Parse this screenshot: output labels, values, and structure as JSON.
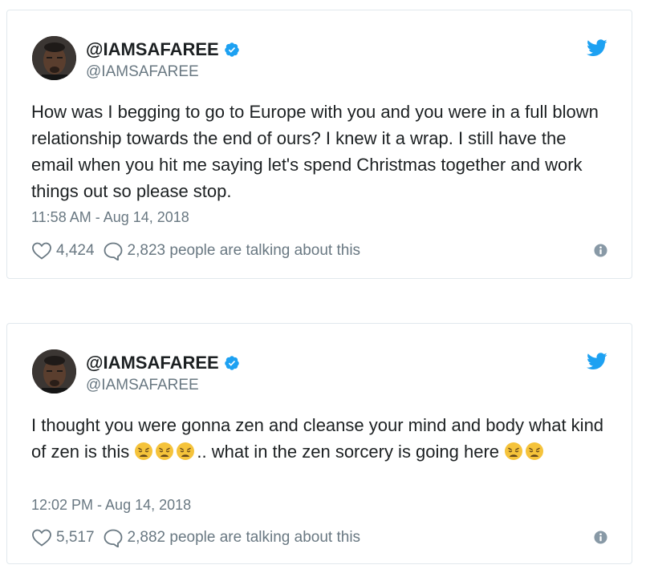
{
  "tweets": [
    {
      "author": {
        "display_name": "@IAMSAFAREE",
        "handle": "@IAMSAFAREE",
        "verified": true
      },
      "text": "How was I begging to go to Europe with you and you were in a full blown relationship towards the end of ours? I knew it a wrap. I still have the email when you hit me saying let's spend Christmas together and work things out so please stop.",
      "timestamp": "11:58 AM - Aug 14, 2018",
      "likes": "4,424",
      "talking": "2,823 people are talking about this"
    },
    {
      "author": {
        "display_name": "@IAMSAFAREE",
        "handle": "@IAMSAFAREE",
        "verified": true
      },
      "text_part1": "I thought you were gonna zen and cleanse  your mind and body what kind of zen is this ",
      "text_part2": ".. what in the zen sorcery is going here ",
      "emoji_name": "weary-face-emoji",
      "timestamp": "12:02 PM - Aug 14, 2018",
      "likes": "5,517",
      "talking": "2,882 people are talking about this"
    }
  ],
  "colors": {
    "text": "#1c2022",
    "muted": "#697882",
    "twitter_blue": "#1da1f2",
    "border": "#e1e8ed"
  },
  "icons": {
    "brand": "twitter-bird-icon",
    "verified": "verified-badge-icon",
    "like": "heart-icon",
    "reply": "speech-bubble-icon",
    "info": "info-icon"
  }
}
